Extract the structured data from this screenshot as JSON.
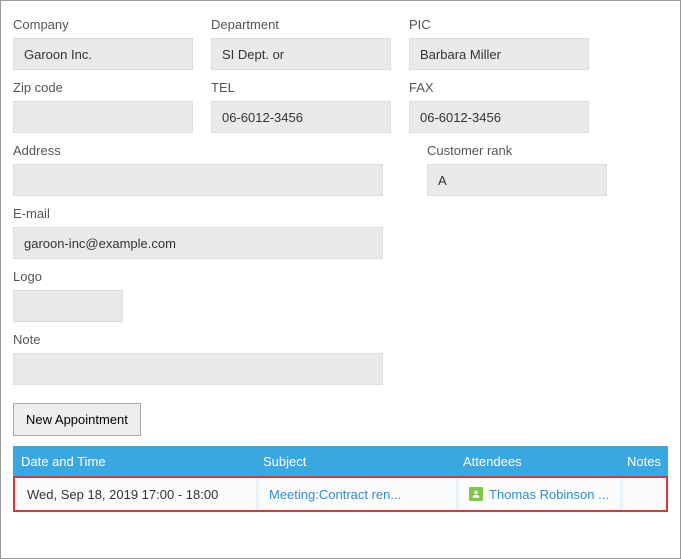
{
  "fields": {
    "company": {
      "label": "Company",
      "value": "Garoon Inc."
    },
    "department": {
      "label": "Department",
      "value": "SI Dept. or"
    },
    "pic": {
      "label": "PIC",
      "value": "Barbara Miller"
    },
    "zip": {
      "label": "Zip code",
      "value": ""
    },
    "tel": {
      "label": "TEL",
      "value": "06-6012-3456"
    },
    "fax": {
      "label": "FAX",
      "value": "06-6012-3456"
    },
    "address": {
      "label": "Address",
      "value": ""
    },
    "rank": {
      "label": "Customer rank",
      "value": "A"
    },
    "email": {
      "label": "E-mail",
      "value": "garoon-inc@example.com"
    },
    "logo": {
      "label": "Logo",
      "value": ""
    },
    "note": {
      "label": "Note",
      "value": ""
    }
  },
  "buttons": {
    "new_appointment": "New Appointment"
  },
  "table": {
    "headers": {
      "datetime": "Date and Time",
      "subject": "Subject",
      "attendees": "Attendees",
      "notes": "Notes"
    },
    "row": {
      "datetime": "Wed, Sep 18, 2019 17:00 - 18:00",
      "subject": "Meeting:Contract ren...",
      "attendee": "Thomas Robinson ..."
    }
  }
}
